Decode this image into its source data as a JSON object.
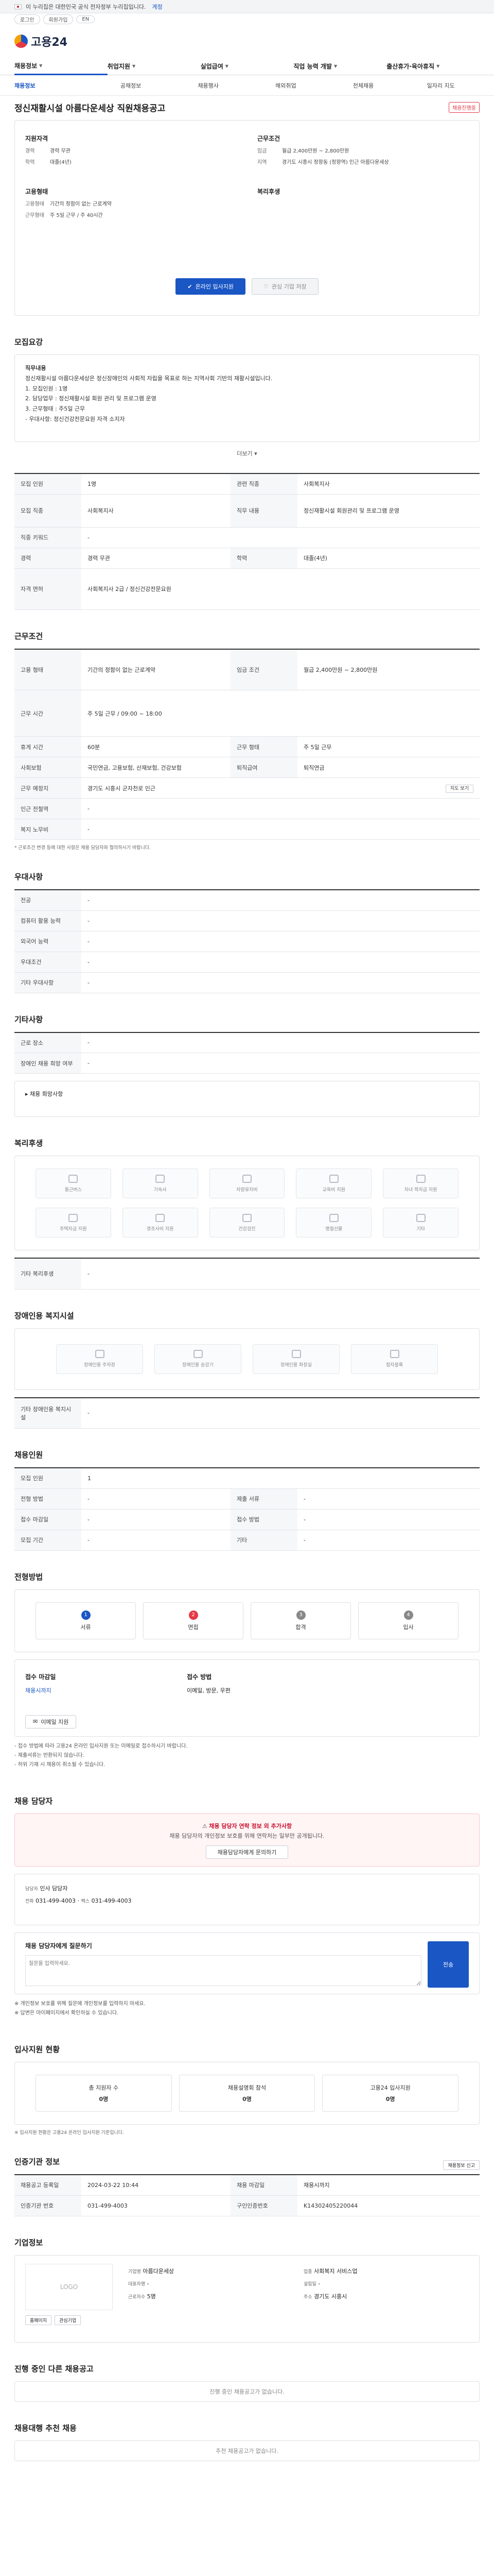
{
  "gov": {
    "text": "이 누리집은 대한민국 공식 전자정부 누리집입니다.",
    "toggle": "계정"
  },
  "util": {
    "login": "로그인",
    "join": "회원가입",
    "lang": "EN"
  },
  "logo": {
    "text": "고용24"
  },
  "gnb": [
    {
      "label": "채용정보"
    },
    {
      "label": "취업지원"
    },
    {
      "label": "실업급여"
    },
    {
      "label": "직업 능력 개발"
    },
    {
      "label": "출산휴가·육아휴직"
    }
  ],
  "subnav": [
    "채용정보",
    "공채정보",
    "채용행사",
    "해외취업",
    "전체채용",
    "일자리 지도"
  ],
  "page": {
    "title": "정신재활시설 아름다운세상 직원채용공고",
    "status": "채용진행중"
  },
  "summary": {
    "company_h": "지원자격",
    "company_rows": [
      {
        "k": "경력",
        "v": "경력 무관"
      },
      {
        "k": "학력",
        "v": "대졸(4년)"
      }
    ],
    "cond_h": "근무조건",
    "cond_rows": [
      {
        "k": "임금",
        "v": "월급 2,400만원 ~ 2,800만원"
      },
      {
        "k": "지역",
        "v": "경기도 시흥시 정왕동 (정왕역) 인근 아름다운세상"
      }
    ],
    "form_h": "고용형태",
    "form_rows": [
      {
        "k": "고용형태",
        "v": "기간의 정함이 없는 근로계약"
      },
      {
        "k": "근무형태",
        "v": "주 5일 근무 / 주 40시간"
      }
    ],
    "etc_h": "복리후생",
    "btn_apply": "온라인 입사지원",
    "btn_interest": "관심 기업 저장"
  },
  "duty": {
    "h": "모집요강",
    "title": "직무내용",
    "lines": [
      "정신재활시설 아름다운세상은 정신장애인의 사회적 자립을 목표로 하는 지역사회 기반의 재활시설입니다.",
      "1. 모집인원 : 1명",
      "2. 담당업무 : 정신재활시설 회원 관리 및 프로그램 운영",
      "3. 근무형태 : 주5일 근무",
      "- 우대사항: 정신건강전문요원 자격 소지자"
    ],
    "more": "더보기"
  },
  "req": {
    "rows": [
      {
        "k1": "모집 인원",
        "v1": "1명",
        "k2": "관련 직종",
        "v2": "사회복지사"
      },
      {
        "k1": "모집 직종",
        "v1": "사회복지사",
        "k2": "직무 내용",
        "v2": "정신재활시설 회원관리 및 프로그램 운영"
      },
      {
        "k1": "직종 키워드",
        "v1": "-",
        "k2": "",
        "v2": ""
      },
      {
        "k1": "경력",
        "v1": "경력 무관",
        "k2": "학력",
        "v2": "대졸(4년)"
      },
      {
        "k1": "자격 면허",
        "v1": "사회복지사 2급 / 정신건강전문요원",
        "k2": "",
        "v2": ""
      }
    ]
  },
  "work": {
    "h": "근무조건",
    "rows": [
      {
        "k1": "고용 형태",
        "v1": "기간의 정함이 없는 근로계약",
        "k2": "임금 조건",
        "v2": "월급 2,400만원 ~ 2,800만원"
      },
      {
        "k1": "근무 예정지",
        "v1": "경기도 시흥시 정왕동",
        "k2": "",
        "v2": ""
      },
      {
        "k1": "근무 시간",
        "v1": "주 5일 근무 / 09:00 ~ 18:00",
        "k2": "",
        "v2": ""
      },
      {
        "k1": "휴게 시간",
        "v1": "60분",
        "k2": "근무 형태",
        "v2": "주 5일 근무"
      },
      {
        "k1": "사회보험",
        "v1": "국민연금, 고용보험, 산재보험, 건강보험",
        "k2": "퇴직급여",
        "v2": "퇴직연금"
      },
      {
        "k1": "근무 예정지",
        "v1": "경기도 시흥시 군자천로 인근",
        "k2": "",
        "v2": ""
      },
      {
        "k1": "인근 전철역",
        "v1": "-",
        "k2": "",
        "v2": ""
      },
      {
        "k1": "복지 노무비",
        "v1": "-",
        "k2": "",
        "v2": ""
      }
    ],
    "map_btn": "지도 보기",
    "note": "* 근로조건 변경 등에 대한 사항은 채용 담당자와 협의하시기 바랍니다."
  },
  "prefer": {
    "h": "우대사항",
    "rows": [
      {
        "k": "전공",
        "v": "-"
      },
      {
        "k": "컴퓨터 활용 능력",
        "v": "-"
      },
      {
        "k": "외국어 능력",
        "v": "-"
      },
      {
        "k": "우대조건",
        "v": "-"
      },
      {
        "k": "기타 우대사항",
        "v": "-"
      }
    ]
  },
  "etc": {
    "h": "기타사항",
    "rows": [
      {
        "k": "근로 장소",
        "v": "-"
      },
      {
        "k": "장애인 채용 희망 여부",
        "v": "-"
      }
    ],
    "extra": "채용 희망사항"
  },
  "welfare": {
    "h": "복리후생",
    "items": [
      "통근버스",
      "기숙사",
      "차량유지비",
      "교육비 지원",
      "자녀 학자금 지원",
      "주택자금 지원",
      "경조사비 지원",
      "건강검진",
      "명절선물",
      "기타"
    ],
    "other_h": "기타 복리후생",
    "other_v": "-"
  },
  "disab": {
    "h": "장애인용 복지시설",
    "items": [
      "장애인용 주차장",
      "장애인용 승강기",
      "장애인용 화장실",
      "점자블록"
    ],
    "other_h": "기타 장애인용 복지시설",
    "other_v": "-"
  },
  "recruit": {
    "h": "채용인원",
    "rows": [
      {
        "k1": "모집 인원",
        "v1": "1",
        "k2": "",
        "v2": ""
      },
      {
        "k1": "전형 방법",
        "v1": "-",
        "k2": "제출 서류",
        "v2": "-"
      },
      {
        "k1": "접수 마감일",
        "v1": "-",
        "k2": "접수 방법",
        "v2": "-"
      },
      {
        "k1": "모집 기간",
        "v1": "-",
        "k2": "기타",
        "v2": "-"
      }
    ]
  },
  "steps": {
    "h": "전형방법",
    "items": [
      "서류",
      "면접",
      "합격",
      "입사"
    ]
  },
  "apply": {
    "h1": "접수 마감일",
    "v1": "채용시까지",
    "h2": "접수 방법",
    "v2": "이메일, 방문, 우편",
    "btn": "이메일 지원",
    "bullets": [
      "- 접수 방법에 따라 고용24 온라인 입사지원 또는 이메일로 접수하시기 바랍니다.",
      "- 제출서류는 반환되지 않습니다.",
      "- 허위 기재 시 채용이 취소될 수 있습니다."
    ]
  },
  "contact": {
    "h": "채용 담당자",
    "alert_title": "채용 담당자 연락 정보 외 추가사항",
    "alert_body": "채용 담당자의 개인정보 보호를 위해 연락처는 일부만 공개됩니다.",
    "btn": "채용담당자에게 문의하기",
    "name_k": "담당자",
    "name_v": "인사 담당자",
    "tel_k": "전화",
    "tel_v": "031-499-4003",
    "fax_k": "팩스",
    "fax_v": "031-499-4003",
    "msg_h": "채용 담당자에게 질문하기",
    "msg_ph": "질문을 입력하세요.",
    "send": "전송",
    "notes": [
      "※ 개인정보 보호를 위해 질문에 개인정보를 입력하지 마세요.",
      "※ 답변은 마이페이지에서 확인하실 수 있습니다."
    ]
  },
  "stats": {
    "h": "입사지원 현황",
    "items": [
      {
        "label": "총 지원자 수",
        "v": "0명"
      },
      {
        "label": "채용설명회 참석",
        "v": "0명"
      },
      {
        "label": "고용24 입사지원",
        "v": "0명"
      }
    ],
    "note": "※ 입사지원 현황은 고용24 온라인 입사지원 기준입니다."
  },
  "regist": {
    "h": "인증기관 정보",
    "btn": "채용정보 신고",
    "rows": [
      {
        "k1": "채용공고 등록일",
        "v1": "2024-03-22 10:44",
        "k2": "채용 마감일",
        "v2": "채용시까지"
      },
      {
        "k1": "인증기관 번호",
        "v1": "031-499-4003",
        "k2": "구인인증번호",
        "v2": "K14302405220044"
      }
    ]
  },
  "company": {
    "h": "기업정보",
    "logo": "LOGO",
    "btn1": "홈페이지",
    "btn2": "관심기업",
    "rows": [
      {
        "k": "기업명",
        "v": "아름다운세상"
      },
      {
        "k": "업종",
        "v": "사회복지 서비스업"
      },
      {
        "k": "대표자명",
        "v": "-"
      },
      {
        "k": "설립일",
        "v": "-"
      },
      {
        "k": "근로자수",
        "v": "5명"
      },
      {
        "k": "주소",
        "v": "경기도 시흥시"
      }
    ]
  },
  "other": {
    "h": "진행 중인 다른 채용공고",
    "empty": "진행 중인 채용공고가 없습니다.",
    "h2": "채용대행 추천 채용",
    "empty2": "추천 채용공고가 없습니다."
  }
}
